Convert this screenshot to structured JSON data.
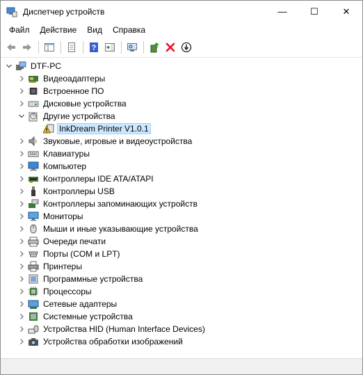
{
  "window": {
    "title": "Диспетчер устройств",
    "minimize": "—",
    "maximize": "☐",
    "close": "✕"
  },
  "menu": [
    "Файл",
    "Действие",
    "Вид",
    "Справка"
  ],
  "tree": {
    "root": "DTF-PC",
    "categories": [
      {
        "label": "Видеоадаптеры",
        "icon": "display-adapter-icon"
      },
      {
        "label": "Встроенное ПО",
        "icon": "firmware-icon"
      },
      {
        "label": "Дисковые устройства",
        "icon": "disk-drive-icon"
      },
      {
        "label": "Другие устройства",
        "icon": "other-devices-icon",
        "expanded": true,
        "children": [
          {
            "label": "InkDream Printer V1.0.1",
            "icon": "warning-device-icon",
            "selected": true
          }
        ]
      },
      {
        "label": "Звуковые, игровые и видеоустройства",
        "icon": "speaker-icon"
      },
      {
        "label": "Клавиатуры",
        "icon": "keyboard-icon"
      },
      {
        "label": "Компьютер",
        "icon": "computer-icon"
      },
      {
        "label": "Контроллеры IDE ATA/ATAPI",
        "icon": "ide-controller-icon"
      },
      {
        "label": "Контроллеры USB",
        "icon": "usb-icon"
      },
      {
        "label": "Контроллеры запоминающих устройств",
        "icon": "storage-controller-icon"
      },
      {
        "label": "Мониторы",
        "icon": "monitor-icon"
      },
      {
        "label": "Мыши и иные указывающие устройства",
        "icon": "mouse-icon"
      },
      {
        "label": "Очереди печати",
        "icon": "print-queue-icon"
      },
      {
        "label": "Порты (COM и LPT)",
        "icon": "port-icon"
      },
      {
        "label": "Принтеры",
        "icon": "printer-icon"
      },
      {
        "label": "Программные устройства",
        "icon": "software-device-icon"
      },
      {
        "label": "Процессоры",
        "icon": "processor-icon"
      },
      {
        "label": "Сетевые адаптеры",
        "icon": "network-adapter-icon"
      },
      {
        "label": "Системные устройства",
        "icon": "system-device-icon"
      },
      {
        "label": "Устройства HID (Human Interface Devices)",
        "icon": "hid-icon"
      },
      {
        "label": "Устройства обработки изображений",
        "icon": "imaging-device-icon"
      }
    ]
  },
  "colors": {
    "selection": "#cce8ff",
    "selection_border": "#99d1ff",
    "remove_red": "#e81123",
    "help_blue": "#3a5fcd"
  }
}
